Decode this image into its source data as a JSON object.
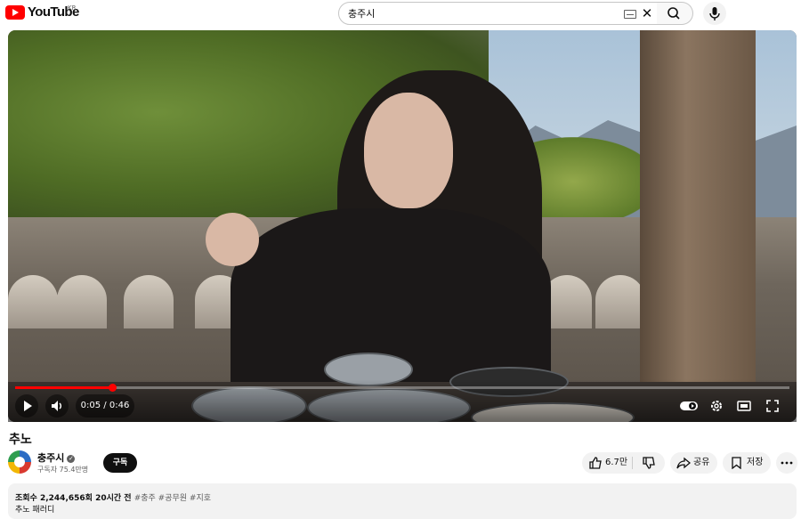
{
  "header": {
    "logo_text": "YouTube",
    "country_code": "KR",
    "search_value": "충주시",
    "icons": [
      "keyboard-icon",
      "clear-icon",
      "search-icon",
      "microphone-icon"
    ]
  },
  "player": {
    "time_current": "0:05",
    "time_total": "0:46",
    "time_display": "0:05 / 0:46",
    "progress": 0.125,
    "autoplay": true,
    "progress_color": "#ff0000"
  },
  "video": {
    "title": "추노",
    "channel": "충주시",
    "verified": true,
    "subscribers": "구독자 75.4만명",
    "subscribe_label": "구독",
    "likes": "6.7만",
    "share_label": "공유",
    "save_label": "저장"
  },
  "description": {
    "views": "조회수 2,244,656회",
    "age": "20시간 전",
    "hashtags": "#충주 #공무원 #지호",
    "text": "추노 패러디"
  }
}
